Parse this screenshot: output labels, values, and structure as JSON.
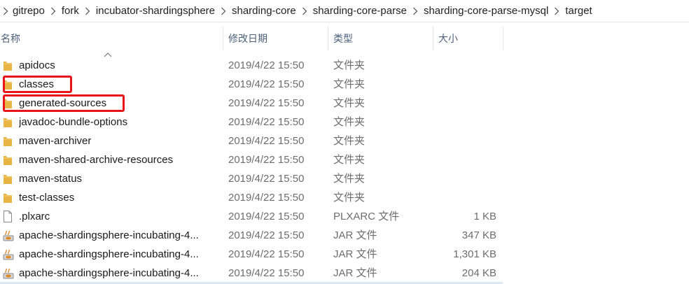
{
  "breadcrumb": {
    "separator_icon": "chevron-right-icon",
    "items": [
      {
        "label": "gitrepo"
      },
      {
        "label": "fork"
      },
      {
        "label": "incubator-shardingsphere"
      },
      {
        "label": "sharding-core"
      },
      {
        "label": "sharding-core-parse"
      },
      {
        "label": "sharding-core-parse-mysql"
      },
      {
        "label": "target"
      }
    ]
  },
  "columns": {
    "name": "名称",
    "date": "修改日期",
    "type": "类型",
    "size": "大小",
    "sorted_by": "name",
    "sort_indicator": "^"
  },
  "files": [
    {
      "name": "apidocs",
      "date": "2019/4/22 15:50",
      "type": "文件夹",
      "size": "",
      "icon": "folder-icon",
      "highlighted": false
    },
    {
      "name": "classes",
      "date": "2019/4/22 15:50",
      "type": "文件夹",
      "size": "",
      "icon": "folder-icon",
      "highlighted": true
    },
    {
      "name": "generated-sources",
      "date": "2019/4/22 15:50",
      "type": "文件夹",
      "size": "",
      "icon": "folder-icon",
      "highlighted": true
    },
    {
      "name": "javadoc-bundle-options",
      "date": "2019/4/22 15:50",
      "type": "文件夹",
      "size": "",
      "icon": "folder-icon",
      "highlighted": false
    },
    {
      "name": "maven-archiver",
      "date": "2019/4/22 15:50",
      "type": "文件夹",
      "size": "",
      "icon": "folder-icon",
      "highlighted": false
    },
    {
      "name": "maven-shared-archive-resources",
      "date": "2019/4/22 15:50",
      "type": "文件夹",
      "size": "",
      "icon": "folder-icon",
      "highlighted": false
    },
    {
      "name": "maven-status",
      "date": "2019/4/22 15:50",
      "type": "文件夹",
      "size": "",
      "icon": "folder-icon",
      "highlighted": false
    },
    {
      "name": "test-classes",
      "date": "2019/4/22 15:50",
      "type": "文件夹",
      "size": "",
      "icon": "folder-icon",
      "highlighted": false
    },
    {
      "name": ".plxarc",
      "date": "2019/4/22 15:50",
      "type": "PLXARC 文件",
      "size": "1 KB",
      "icon": "file-icon",
      "highlighted": false
    },
    {
      "name": "apache-shardingsphere-incubating-4...",
      "date": "2019/4/22 15:50",
      "type": "JAR 文件",
      "size": "347 KB",
      "icon": "jar-icon",
      "highlighted": false
    },
    {
      "name": "apache-shardingsphere-incubating-4...",
      "date": "2019/4/22 15:50",
      "type": "JAR 文件",
      "size": "1,301 KB",
      "icon": "jar-icon",
      "highlighted": false
    },
    {
      "name": "apache-shardingsphere-incubating-4...",
      "date": "2019/4/22 15:50",
      "type": "JAR 文件",
      "size": "204 KB",
      "icon": "jar-icon",
      "highlighted": false
    }
  ],
  "colors": {
    "folder": "#e8b444",
    "highlight_border": "#e8141a",
    "header_text": "#4c607a",
    "secondary_text": "#6d6d6d"
  }
}
